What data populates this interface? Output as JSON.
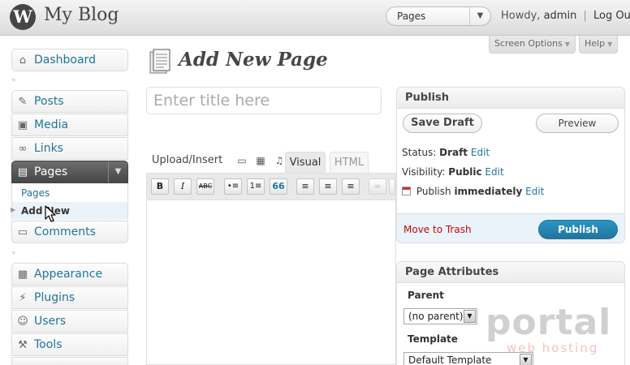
{
  "header": {
    "site_title": "My Blog",
    "favorite_select": "Pages",
    "howdy": "Howdy,",
    "user": "admin",
    "separator": "|",
    "logout": "Log Out"
  },
  "screen_meta": {
    "screen_options": "Screen Options",
    "help": "Help"
  },
  "menu": {
    "dashboard": "Dashboard",
    "posts": "Posts",
    "media": "Media",
    "links": "Links",
    "pages": "Pages",
    "submenu": [
      "Pages",
      "Add New"
    ],
    "comments": "Comments",
    "appearance": "Appearance",
    "plugins": "Plugins",
    "users": "Users",
    "tools": "Tools"
  },
  "page": {
    "title": "Add New Page",
    "title_placeholder": "Enter title here"
  },
  "editor": {
    "upload_insert": "Upload/Insert",
    "tab_visual": "Visual",
    "tab_html": "HTML",
    "toolbar": [
      "B",
      "I",
      "ABC",
      "•≡",
      "1≡",
      "66"
    ]
  },
  "publish": {
    "heading": "Publish",
    "save_draft": "Save Draft",
    "preview": "Preview",
    "status_label": "Status:",
    "status_value": "Draft",
    "visibility_label": "Visibility:",
    "visibility_value": "Public",
    "publish_label": "Publish",
    "publish_value": "immediately",
    "edit": "Edit",
    "move_to_trash": "Move to Trash",
    "publish_button": "Publish"
  },
  "page_attributes": {
    "heading": "Page Attributes",
    "parent_label": "Parent",
    "parent_value": "(no parent)",
    "template_label": "Template",
    "template_value": "Default Template"
  },
  "watermark": {
    "main": "portal",
    "sub": "web hosting"
  },
  "colors": {
    "link": "#21759b",
    "trash": "#bc0b0b",
    "publish_button": "#21759b",
    "menu_current": "#464646"
  }
}
